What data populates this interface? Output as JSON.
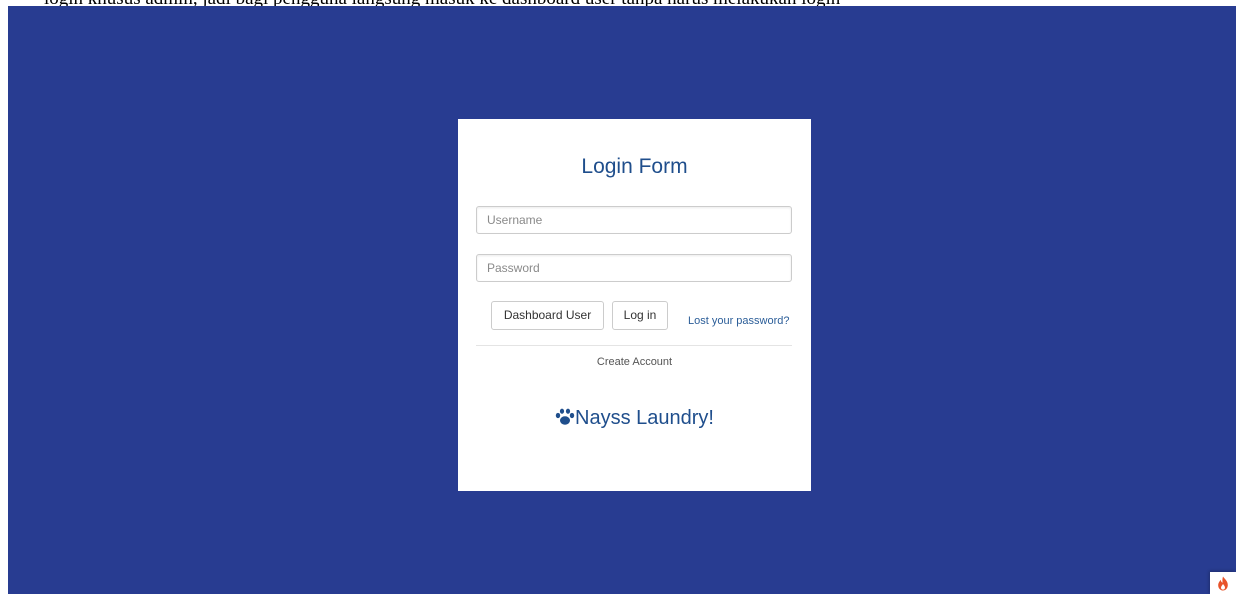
{
  "document": {
    "top_line": "login khusus admin, jadi bagi pengguna langsung masuk ke dashboard user tanpa harus melakukan login"
  },
  "login_form": {
    "title": "Login Form",
    "username_placeholder": "Username",
    "password_placeholder": "Password",
    "dashboard_user_label": "Dashboard User",
    "login_label": "Log in",
    "lost_password_label": "Lost your password?",
    "create_account_label": "Create Account",
    "brand_name": "Nayss Laundry!",
    "brand_icon": "paw-icon"
  },
  "toolbar": {
    "corner_icon": "flame-icon"
  },
  "colors": {
    "background": "#283c91",
    "card": "#ffffff",
    "heading": "#1f4e8c",
    "link": "#2b5d98",
    "flame": "#e8532a"
  }
}
